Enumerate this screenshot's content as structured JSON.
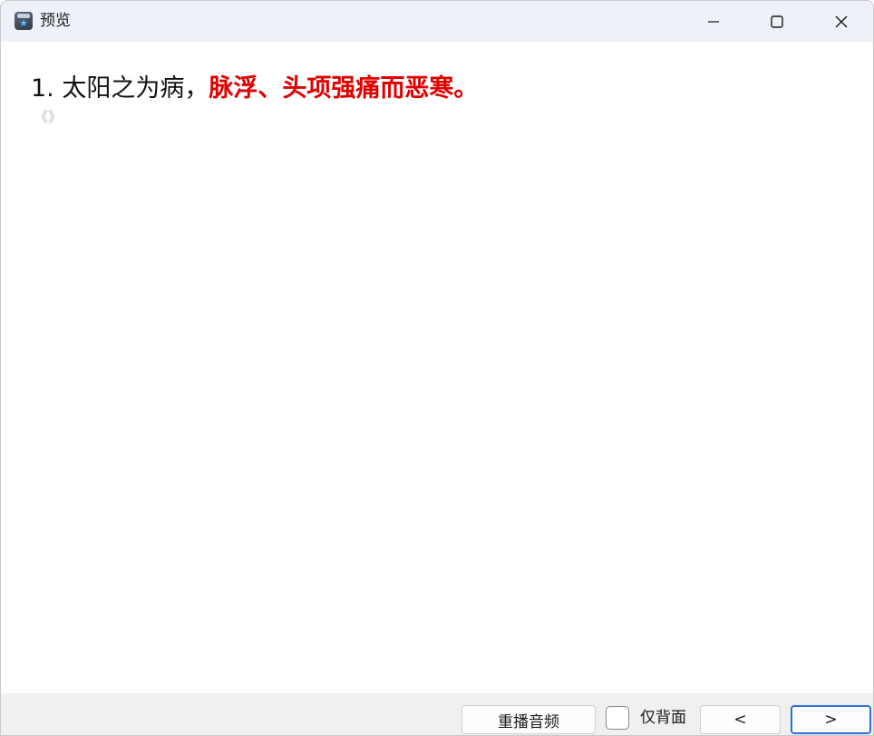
{
  "window": {
    "title": "预览",
    "icon": "app-card-icon"
  },
  "controls": {
    "minimize_icon": "minimize-icon",
    "maximize_icon": "maximize-icon",
    "close_icon": "close-icon"
  },
  "card": {
    "number": "1.",
    "plain_text": "太阳之为病，",
    "highlight_text": "脉浮、头项强痛而恶寒。",
    "source": "《》",
    "highlight_color": "#e00000"
  },
  "bottom": {
    "replay_label": "重播音频",
    "back_only_label": "仅背面",
    "prev_label": "<",
    "next_label": ">"
  }
}
